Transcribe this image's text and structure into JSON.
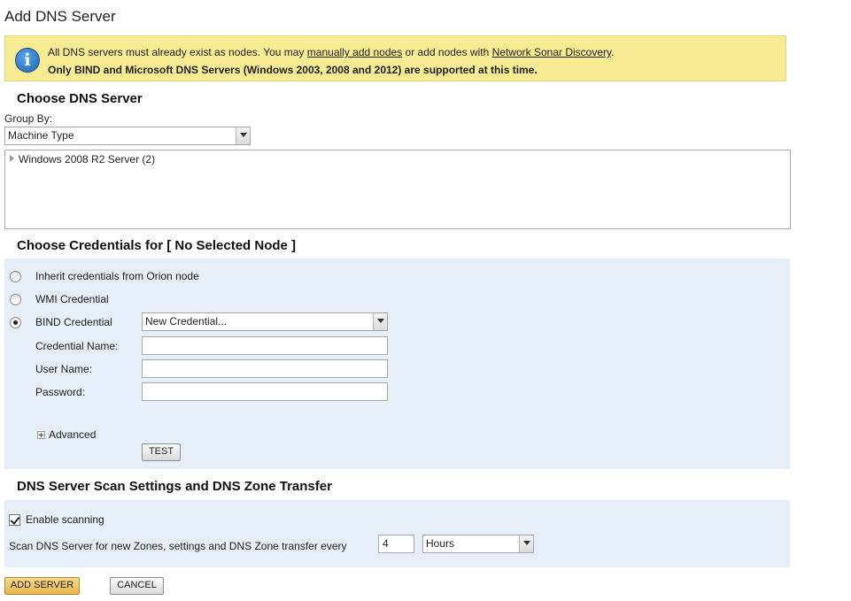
{
  "page": {
    "title": "Add DNS Server"
  },
  "banner": {
    "text_before": "All DNS servers must already exist as nodes. You may ",
    "link_manual": "manually add nodes",
    "text_middle": " or add nodes with ",
    "link_discovery": "Network Sonar Discovery",
    "text_after": ".",
    "line2": "Only BIND and Microsoft DNS Servers (Windows 2003, 2008 and 2012) are supported at this time."
  },
  "choose_server": {
    "heading": "Choose DNS Server",
    "group_by_label": "Group By:",
    "group_by_value": "Machine Type",
    "tree_items": [
      "Windows 2008 R2 Server (2)"
    ]
  },
  "credentials": {
    "heading": "Choose Credentials for [ No Selected Node ]",
    "option_inherit": "Inherit credentials from Orion node",
    "option_wmi": "WMI Credential",
    "option_bind": "BIND Credential",
    "selected_option": "BIND Credential",
    "credential_select_value": "New Credential...",
    "credential_name_label": "Credential Name:",
    "user_name_label": "User Name:",
    "password_label": "Password:",
    "credential_name_value": "",
    "user_name_value": "",
    "password_value": "",
    "advanced_label": "Advanced",
    "test_button": "TEST"
  },
  "scan": {
    "heading": "DNS Server Scan Settings and DNS Zone Transfer",
    "enable_label": "Enable scanning",
    "enable_checked": true,
    "interval_label": "Scan DNS Server for new Zones, settings and DNS Zone transfer every",
    "interval_value": "4",
    "interval_unit": "Hours"
  },
  "actions": {
    "add_server": "ADD SERVER",
    "cancel": "CANCEL"
  },
  "icons": {
    "info": "info-icon",
    "tree_expand": "triangle-right-icon",
    "advanced_expand": "plus-icon",
    "dropdown": "chevron-down-icon"
  },
  "colors": {
    "banner_bg": "#f7ec93",
    "panel_bg": "#e6eff8",
    "primary_button": "#e8b54a"
  }
}
